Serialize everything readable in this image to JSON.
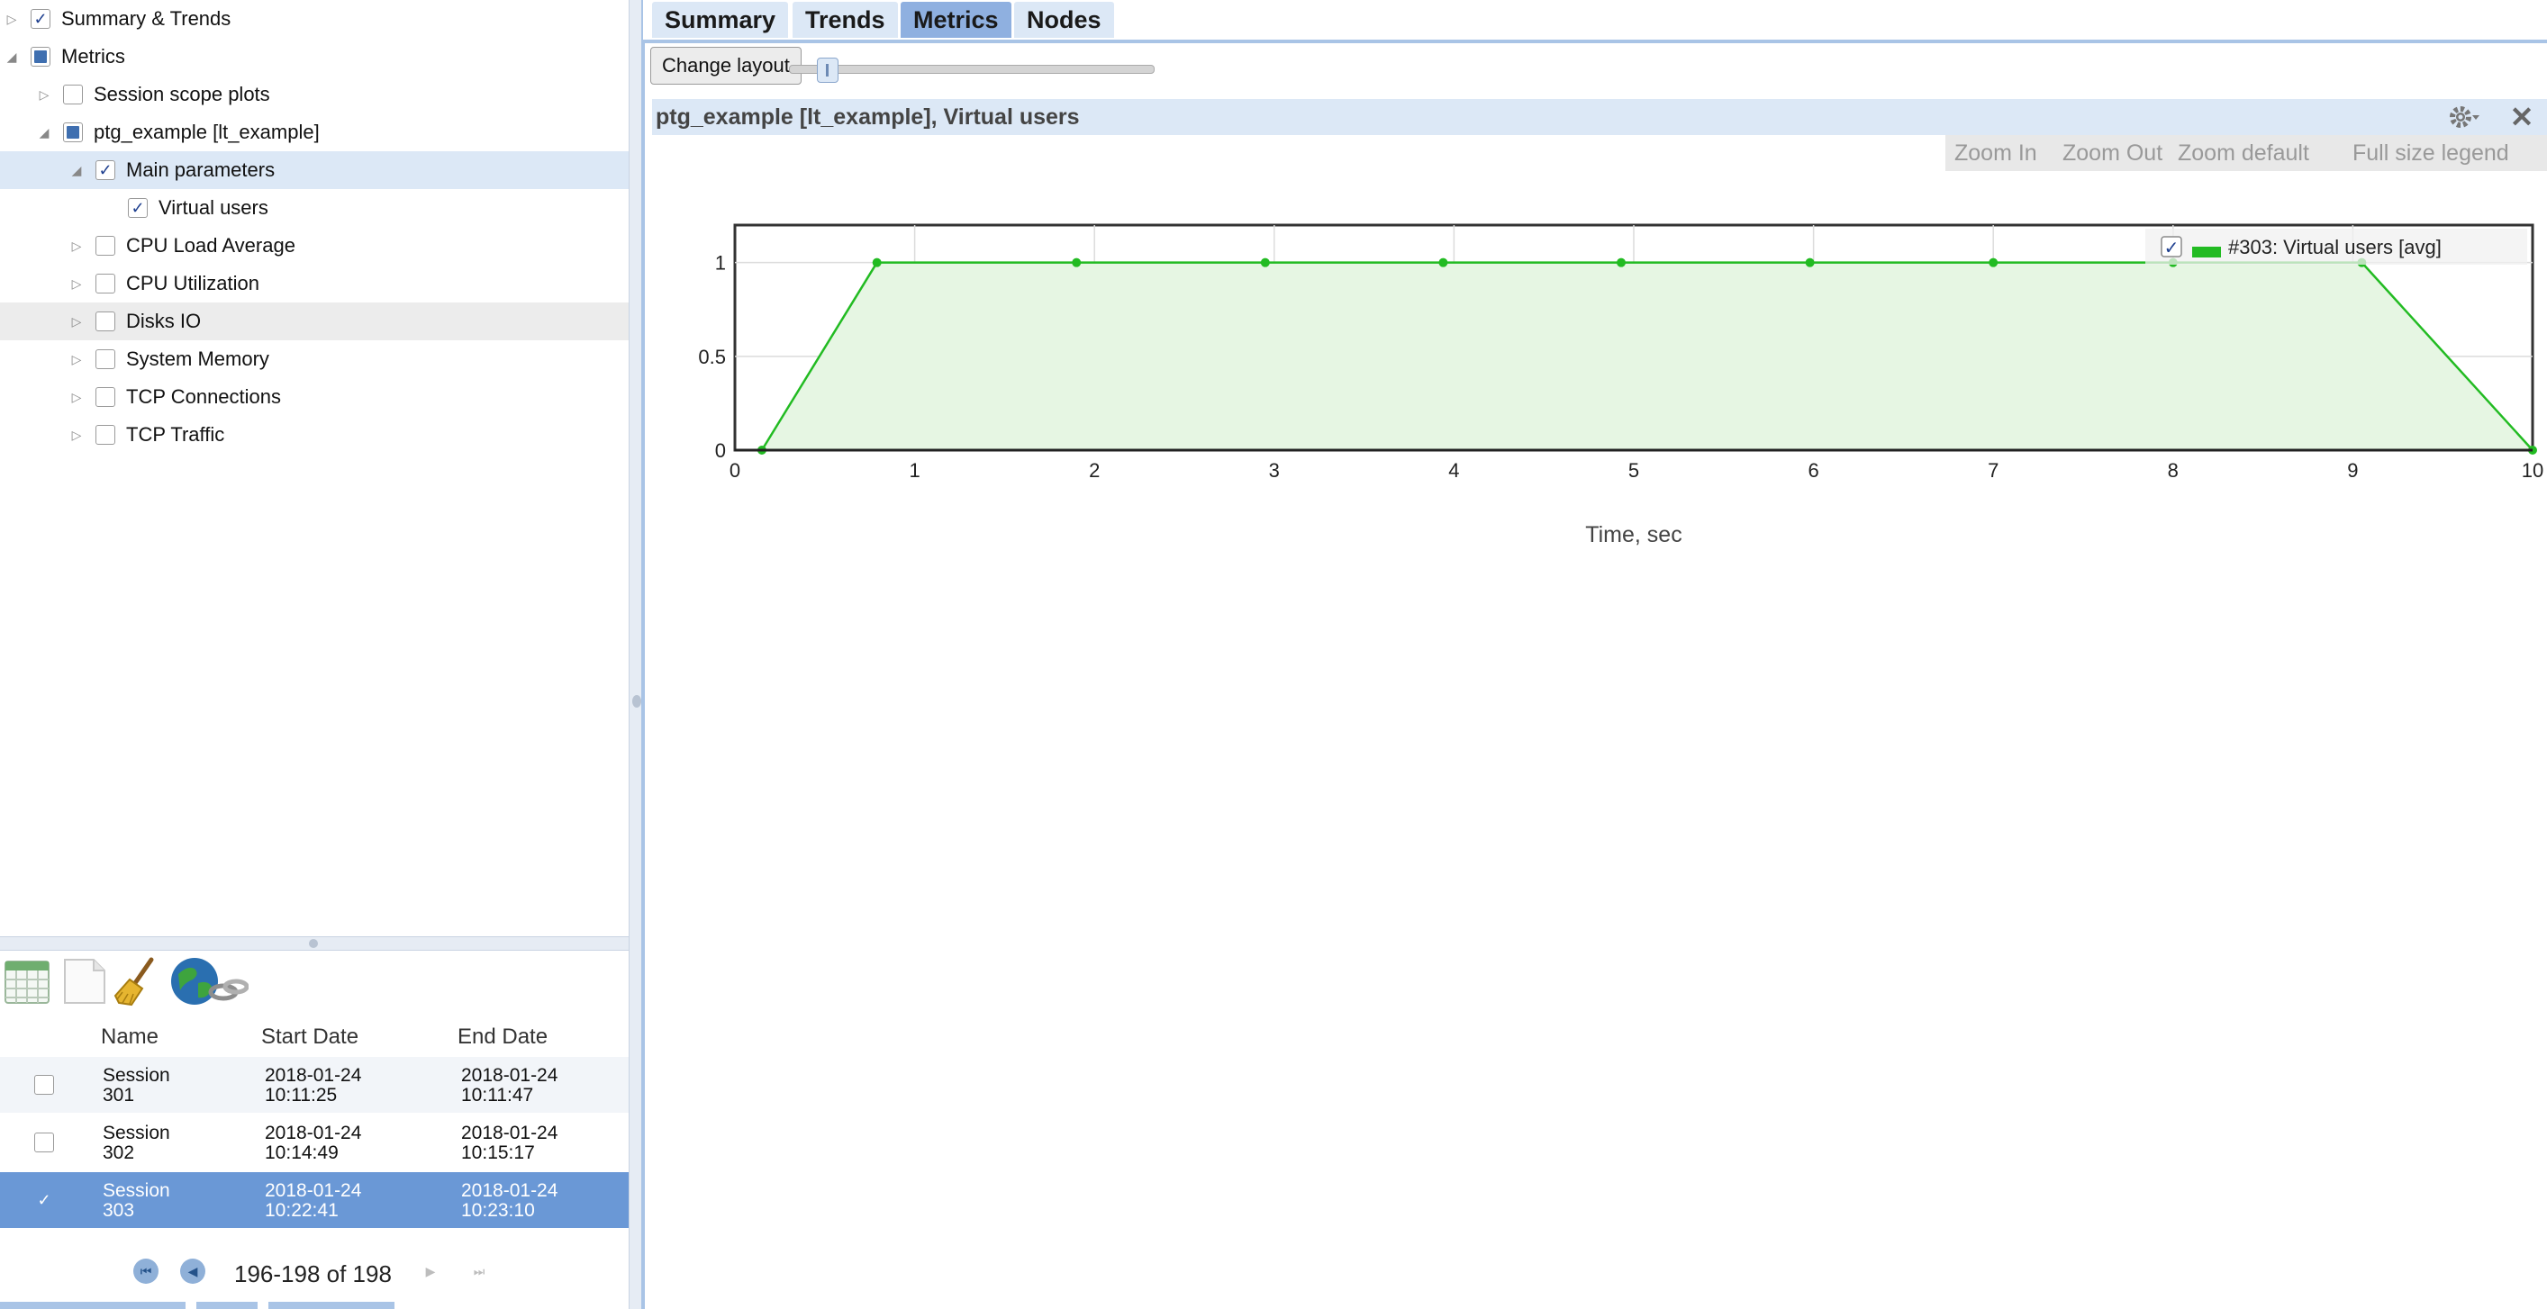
{
  "tree": {
    "items": [
      {
        "label": "Summary & Trends",
        "expander": "collapsed",
        "check": "checked",
        "indent": 0,
        "state": ""
      },
      {
        "label": "Metrics",
        "expander": "expanded",
        "check": "partial",
        "indent": 0,
        "state": ""
      },
      {
        "label": "Session scope plots",
        "expander": "collapsed",
        "check": "unchecked",
        "indent": 1,
        "state": ""
      },
      {
        "label": "ptg_example [lt_example]",
        "expander": "expanded",
        "check": "partial",
        "indent": 1,
        "state": ""
      },
      {
        "label": "Main parameters",
        "expander": "expanded",
        "check": "checked",
        "indent": 2,
        "state": "selected"
      },
      {
        "label": "Virtual users",
        "expander": "none",
        "check": "checked",
        "indent": 3,
        "state": ""
      },
      {
        "label": "CPU Load Average",
        "expander": "collapsed",
        "check": "unchecked",
        "indent": 2,
        "state": ""
      },
      {
        "label": "CPU Utilization",
        "expander": "collapsed",
        "check": "unchecked",
        "indent": 2,
        "state": ""
      },
      {
        "label": "Disks IO",
        "expander": "collapsed",
        "check": "unchecked",
        "indent": 2,
        "state": "hover"
      },
      {
        "label": "System Memory",
        "expander": "collapsed",
        "check": "unchecked",
        "indent": 2,
        "state": ""
      },
      {
        "label": "TCP Connections",
        "expander": "collapsed",
        "check": "unchecked",
        "indent": 2,
        "state": ""
      },
      {
        "label": "TCP Traffic",
        "expander": "collapsed",
        "check": "unchecked",
        "indent": 2,
        "state": ""
      }
    ]
  },
  "toolbar": {
    "icons": [
      "calendar-grid-icon",
      "blank-page-icon",
      "broom-icon",
      "globe-link-icon"
    ]
  },
  "sessions": {
    "columns": {
      "name": "Name",
      "start": "Start Date",
      "end": "End Date"
    },
    "rows": [
      {
        "name": "Session 301",
        "start": "2018-01-24 10:11:25",
        "end": "2018-01-24 10:11:47",
        "checked": false
      },
      {
        "name": "Session 302",
        "start": "2018-01-24 10:14:49",
        "end": "2018-01-24 10:15:17",
        "checked": false
      },
      {
        "name": "Session 303",
        "start": "2018-01-24 10:22:41",
        "end": "2018-01-24 10:23:10",
        "checked": true
      }
    ],
    "pager": "196-198 of 198"
  },
  "tabs": [
    {
      "label": "Summary",
      "active": false
    },
    {
      "label": "Trends",
      "active": false
    },
    {
      "label": "Metrics",
      "active": true
    },
    {
      "label": "Nodes",
      "active": false
    }
  ],
  "layout": {
    "change_layout_label": "Change layout",
    "slider_value": 0.08
  },
  "plot": {
    "title": "ptg_example [lt_example], Virtual users",
    "zoom": {
      "zoom_in": "Zoom In",
      "zoom_out": "Zoom Out",
      "zoom_default": "Zoom default",
      "full_legend": "Full size legend"
    }
  },
  "colors": {
    "series": "#22bb22",
    "series_fill": "#e6f6e3",
    "accent": "#a9c4e6",
    "selected_row": "#6a98d6"
  },
  "chart_data": {
    "type": "area",
    "x": [
      0.15,
      0.79,
      1.9,
      2.95,
      3.94,
      4.93,
      5.98,
      7.0,
      8.0,
      9.05,
      10.0
    ],
    "series": [
      {
        "name": "#303: Virtual users [avg]",
        "values": [
          0,
          1,
          1,
          1,
          1,
          1,
          1,
          1,
          1,
          1,
          0
        ],
        "checked": true
      }
    ],
    "xlabel": "Time, sec",
    "ylabel": "",
    "xlim": [
      0,
      10
    ],
    "ylim": [
      0,
      1.2
    ],
    "xticks": [
      0,
      1,
      2,
      3,
      4,
      5,
      6,
      7,
      8,
      9,
      10
    ],
    "yticks": [
      0,
      0.5,
      1
    ],
    "ytick_labels": [
      "0",
      "0.5",
      "1"
    ],
    "grid": true,
    "legend": "top-right"
  }
}
